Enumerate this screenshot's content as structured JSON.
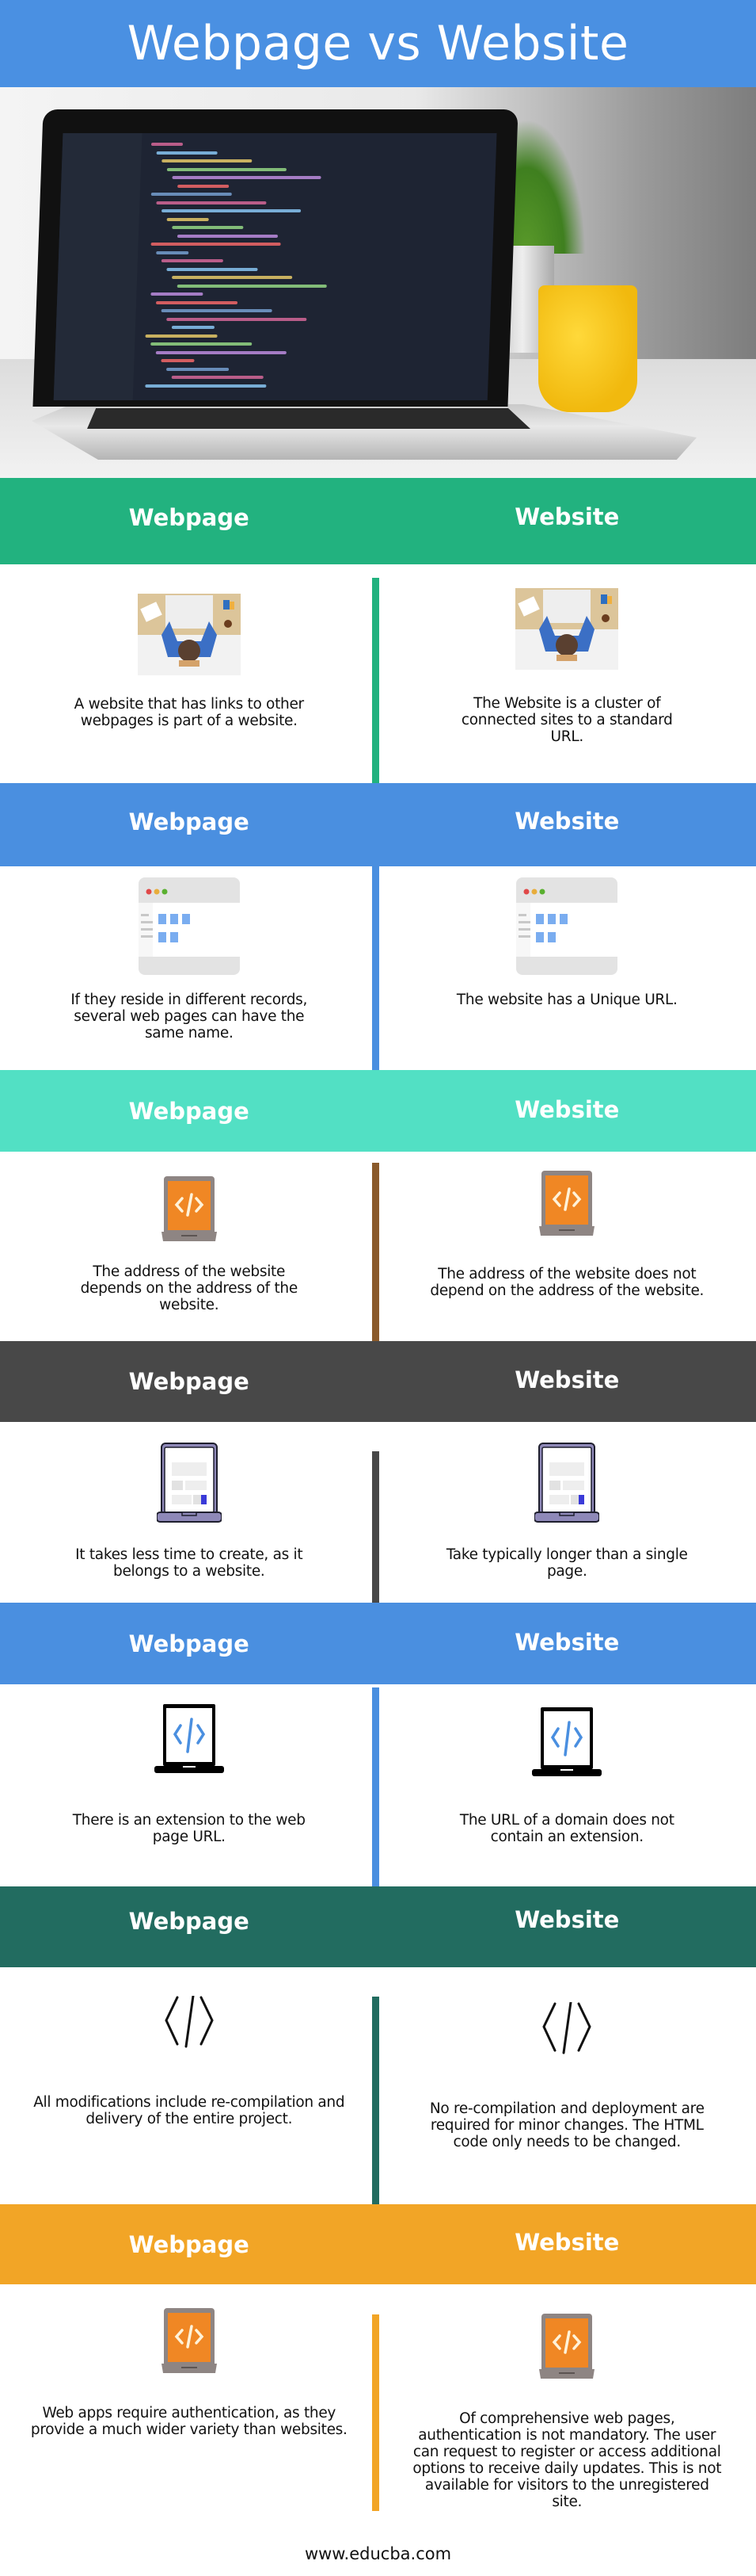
{
  "header": {
    "title": "Webpage vs Website"
  },
  "photo": {
    "subject": "laptop-with-code-editor-photo"
  },
  "comparisons": [
    {
      "color": "#22b27f",
      "left_label": "Webpage",
      "right_label": "Website",
      "icon": "person-at-desk-icon",
      "left_text": "A website that has links to other webpages is part of a website.",
      "right_text": "The Website is a cluster of connected sites to a standard URL."
    },
    {
      "color": "#4a8fe0",
      "left_label": "Webpage",
      "right_label": "Website",
      "icon": "browser-window-icon",
      "left_text": "If they reside in different records, several web pages can have the same name.",
      "right_text": "The website has a Unique URL."
    },
    {
      "color": "#52e0c4",
      "divider_color": "#8a5a2b",
      "left_label": "Webpage",
      "right_label": "Website",
      "icon": "orange-laptop-code-icon",
      "left_text": "The address of the website depends on the address of the website.",
      "right_text": "The address of the website does not depend on the address of the website."
    },
    {
      "color": "#484848",
      "left_label": "Webpage",
      "right_label": "Website",
      "icon": "purple-laptop-icon",
      "left_text": "It takes less time to create, as it belongs to a website.",
      "right_text": "Take typically longer than a single page."
    },
    {
      "color": "#4a8fe0",
      "left_label": "Webpage",
      "right_label": "Website",
      "icon": "black-laptop-code-icon",
      "left_text": "There is an extension to the web page URL.",
      "right_text": "The URL of a domain does not contain an extension."
    },
    {
      "color": "#226c60",
      "left_label": "Webpage",
      "right_label": "Website",
      "icon": "code-brackets-icon",
      "left_text": "All modifications include re-compilation and delivery of the entire project.",
      "right_text": "No re-compilation and deployment are required for minor changes. The HTML code only needs to be changed."
    },
    {
      "color": "#f2a526",
      "left_label": "Webpage",
      "right_label": "Website",
      "icon": "orange-laptop-code-icon",
      "left_text": "Web apps require authentication, as they provide a much wider variety than websites.",
      "right_text": "Of comprehensive web pages, authentication is not mandatory. The user can request to register or access additional options to receive daily updates. This is not available for visitors to the unregistered site."
    }
  ],
  "footer": {
    "url": "www.educba.com"
  }
}
